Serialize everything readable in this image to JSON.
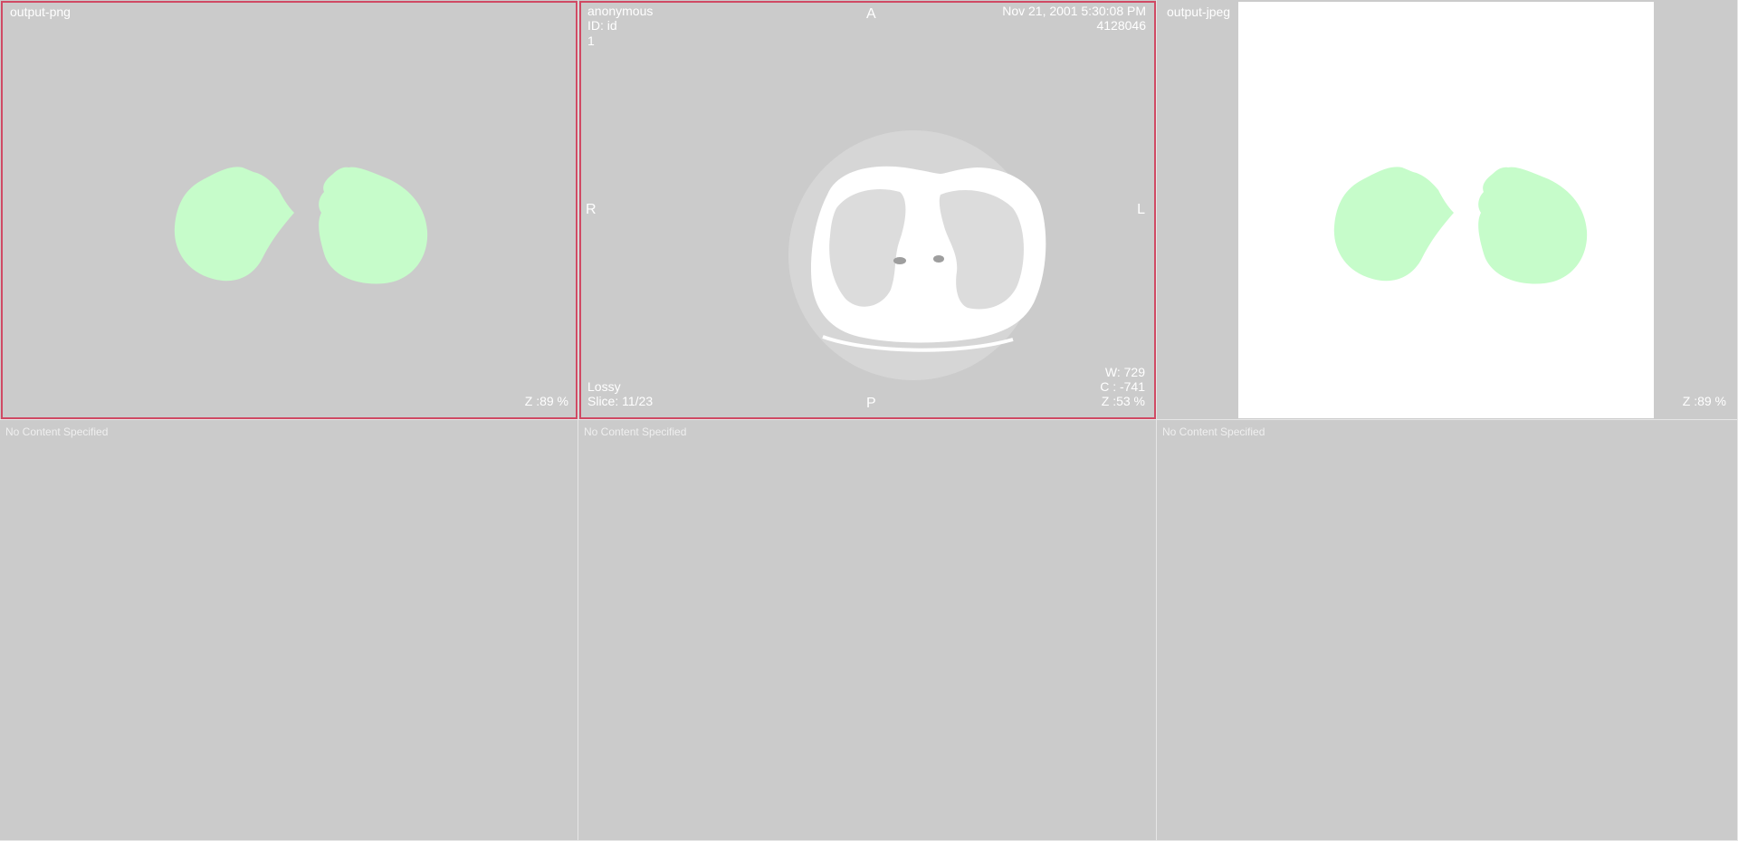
{
  "viewports": {
    "png": {
      "label": "output-png",
      "zoom": "Z :89 %"
    },
    "dicom": {
      "patient_name": "anonymous",
      "patient_id": "ID: id",
      "series_number": "1",
      "study_datetime": "Nov 21, 2001 5:30:08 PM",
      "accession": "4128046",
      "orientation_top": "A",
      "orientation_bottom": "P",
      "orientation_left": "R",
      "orientation_right": "L",
      "compression": "Lossy",
      "slice": "Slice: 11/23",
      "window_width": "W: 729",
      "window_center": "C : -741",
      "zoom": "Z :53 %"
    },
    "jpeg": {
      "label": "output-jpeg",
      "zoom": "Z :89 %"
    },
    "empty": [
      "No Content Specified",
      "No Content Specified",
      "No Content Specified"
    ]
  },
  "colors": {
    "viewport_bg": "#cbcbcb",
    "active_border": "#d04a64",
    "lung_mask": "#c6fcca",
    "overlay_text": "#ffffff"
  }
}
